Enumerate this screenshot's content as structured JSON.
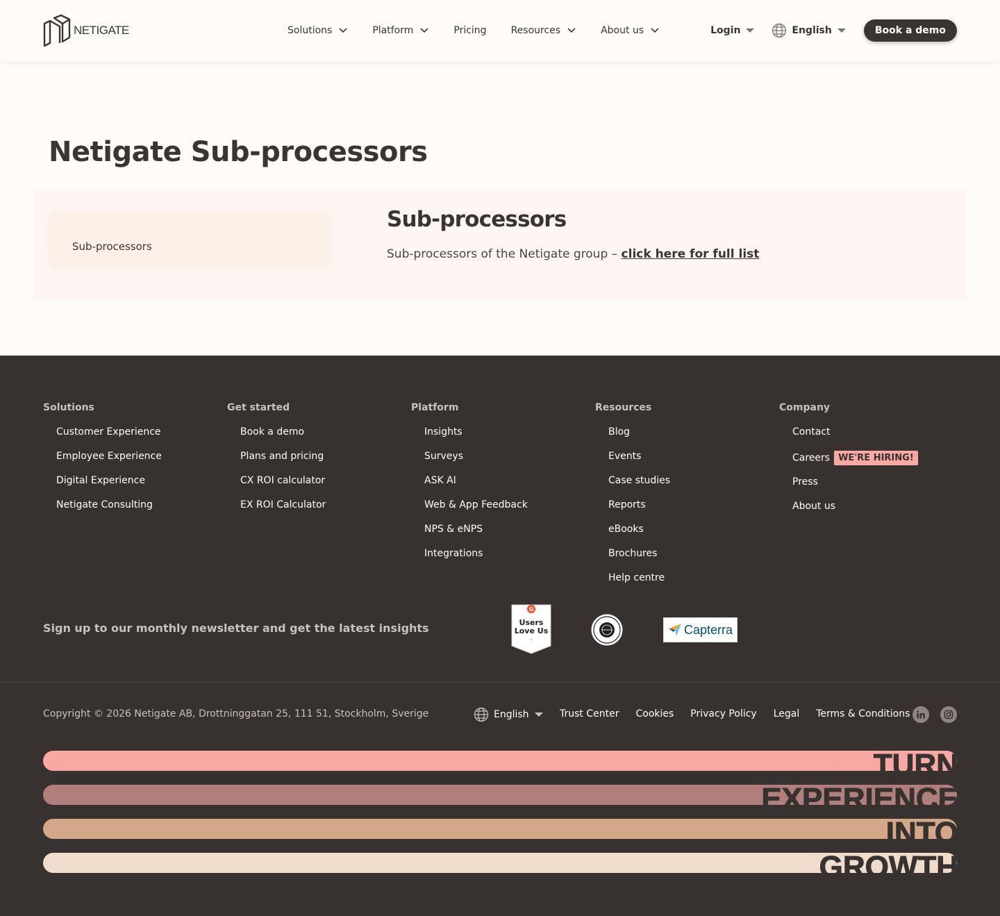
{
  "header": {
    "logo_text": "NETIGATE",
    "nav": [
      {
        "label": "Solutions"
      },
      {
        "label": "Platform"
      },
      {
        "label": "Pricing"
      },
      {
        "label": "Resources"
      },
      {
        "label": "About us"
      }
    ],
    "login_label": "Login",
    "language_label": "English",
    "demo_label": "Book a demo"
  },
  "main": {
    "title": "Netigate Sub-processors",
    "toc_item": "Sub-processors",
    "section_title": "Sub-processors",
    "section_text": "Sub-processors of the Netigate group – ",
    "section_link": "click here for full list"
  },
  "footer": {
    "columns": [
      {
        "title": "Solutions",
        "items": [
          "Customer Experience",
          "Employee Experience",
          "Digital Experience",
          "Netigate Consulting"
        ]
      },
      {
        "title": "Get started",
        "items": [
          "Book a demo",
          "Plans and pricing",
          "CX ROI calculator",
          "EX ROI Calculator"
        ]
      },
      {
        "title": "Platform",
        "items": [
          "Insights",
          "Surveys",
          "ASK AI",
          "Web & App Feedback",
          "NPS & eNPS",
          "Integrations"
        ]
      },
      {
        "title": "Resources",
        "items": [
          "Blog",
          "Events",
          "Case studies",
          "Reports",
          "eBooks",
          "Brochures",
          "Help centre"
        ]
      },
      {
        "title": "Company",
        "items": [
          "Contact",
          "Careers",
          "Press",
          "About us"
        ]
      }
    ],
    "hiring_badge": "WE'RE HIRING!",
    "newsletter": "Sign up to our monthly newsletter and get the latest insights",
    "badges": {
      "g2_line1": "Users",
      "g2_line2": "Love Us",
      "capterra": "Capterra"
    },
    "copyright": "Copyright © 2026 Netigate AB, Drottninggatan 25, 111 51, Stockholm, Sverige",
    "language_label": "English",
    "links": [
      "Trust Center",
      "Cookies",
      "Privacy Policy",
      "Legal",
      "Terms & Conditions"
    ],
    "slogan": [
      "TURN",
      "EXPERIENCE",
      "INTO",
      "GROWTH"
    ],
    "slogan_colors": [
      "#f9a9a3",
      "#b07f7b",
      "#d3a788",
      "#f0dccd"
    ]
  }
}
